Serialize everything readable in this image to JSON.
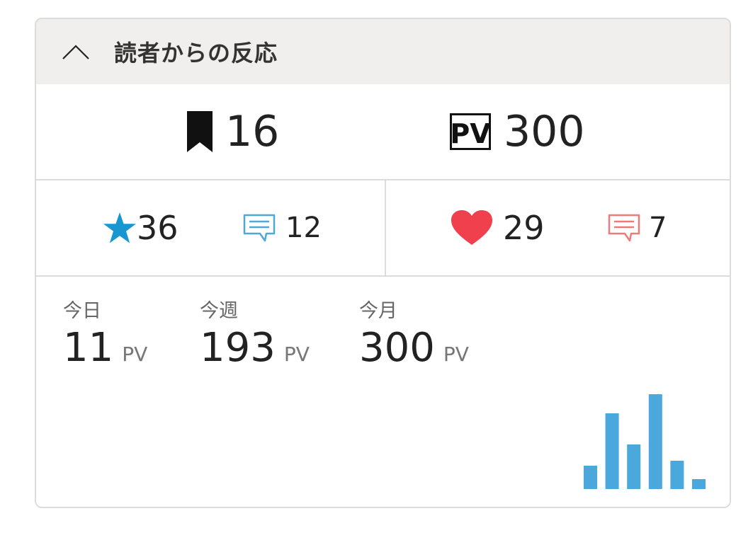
{
  "header": {
    "title": "読者からの反応",
    "toggle_icon": "chevron-up-icon"
  },
  "summary": {
    "bookmarks": {
      "icon": "bookmark-icon",
      "count": "16"
    },
    "pageviews": {
      "icon": "pv-icon",
      "icon_text": "PV",
      "count": "300"
    }
  },
  "reactions": {
    "stars": {
      "icon": "star-icon",
      "count": "36",
      "color": "#1796d2"
    },
    "star_comments": {
      "icon": "comment-icon",
      "count": "12",
      "color": "#4ea8d8"
    },
    "hearts": {
      "icon": "heart-icon",
      "count": "29",
      "color": "#f0404e"
    },
    "heart_comments": {
      "icon": "comment-icon",
      "count": "7",
      "color": "#ef7a7a"
    }
  },
  "pv_stats": {
    "today": {
      "label": "今日",
      "value": "11",
      "unit": "PV"
    },
    "week": {
      "label": "今週",
      "value": "193",
      "unit": "PV"
    },
    "month": {
      "label": "今月",
      "value": "300",
      "unit": "PV"
    }
  },
  "chart_data": {
    "type": "bar",
    "color": "#4aa8dc",
    "values": [
      33,
      107,
      63,
      134,
      40,
      14
    ],
    "ylim": [
      0,
      140
    ]
  }
}
